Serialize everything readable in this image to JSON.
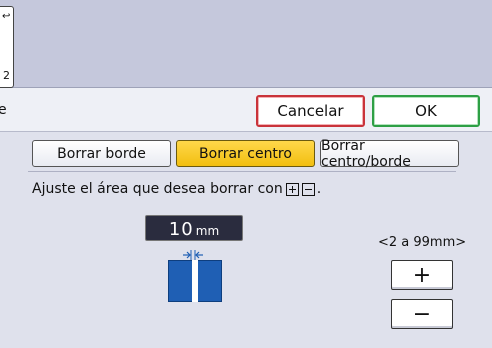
{
  "top": {
    "partial_glyph": "↩",
    "partial_number": "2"
  },
  "header": {
    "left_glyph": "e",
    "cancel_label": "Cancelar",
    "ok_label": "OK"
  },
  "tabs": [
    {
      "label": "Borrar borde",
      "selected": false
    },
    {
      "label": "Borrar centro",
      "selected": true
    },
    {
      "label": "Borrar centro/borde",
      "selected": false
    }
  ],
  "instruction": {
    "text": "Ajuste el área que desea borrar con",
    "end": "."
  },
  "value": {
    "number": "10",
    "unit": "mm"
  },
  "range": "<2 a 99mm>",
  "steppers": {
    "plus": "+",
    "minus": "−"
  },
  "colors": {
    "selected_tab": "#f2bf10",
    "cancel_border": "#c9333a",
    "ok_border": "#2e9f45",
    "diagram_blue": "#1f5fb4"
  }
}
